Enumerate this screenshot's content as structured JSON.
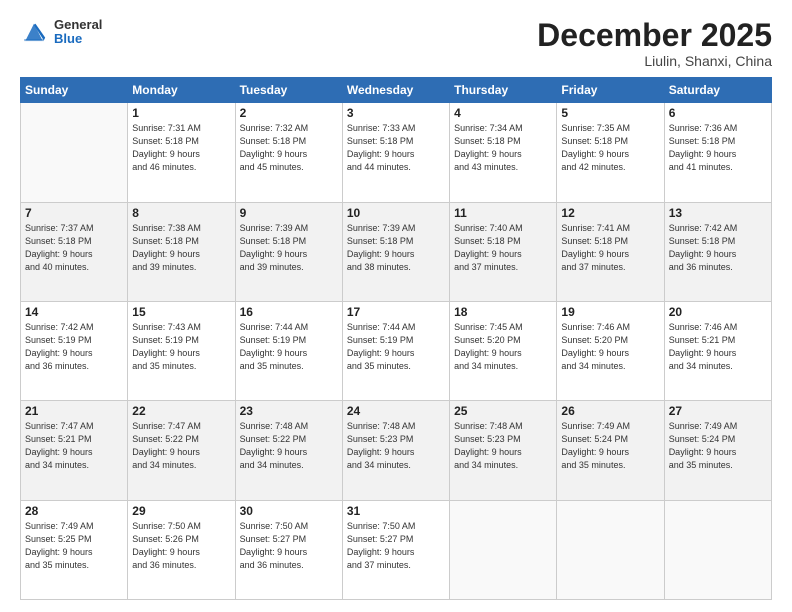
{
  "header": {
    "logo": {
      "general": "General",
      "blue": "Blue"
    },
    "month": "December 2025",
    "location": "Liulin, Shanxi, China"
  },
  "weekdays": [
    "Sunday",
    "Monday",
    "Tuesday",
    "Wednesday",
    "Thursday",
    "Friday",
    "Saturday"
  ],
  "weeks": [
    [
      {
        "day": "",
        "sunrise": "",
        "sunset": "",
        "daylight": ""
      },
      {
        "day": "1",
        "sunrise": "Sunrise: 7:31 AM",
        "sunset": "Sunset: 5:18 PM",
        "daylight": "Daylight: 9 hours and 46 minutes."
      },
      {
        "day": "2",
        "sunrise": "Sunrise: 7:32 AM",
        "sunset": "Sunset: 5:18 PM",
        "daylight": "Daylight: 9 hours and 45 minutes."
      },
      {
        "day": "3",
        "sunrise": "Sunrise: 7:33 AM",
        "sunset": "Sunset: 5:18 PM",
        "daylight": "Daylight: 9 hours and 44 minutes."
      },
      {
        "day": "4",
        "sunrise": "Sunrise: 7:34 AM",
        "sunset": "Sunset: 5:18 PM",
        "daylight": "Daylight: 9 hours and 43 minutes."
      },
      {
        "day": "5",
        "sunrise": "Sunrise: 7:35 AM",
        "sunset": "Sunset: 5:18 PM",
        "daylight": "Daylight: 9 hours and 42 minutes."
      },
      {
        "day": "6",
        "sunrise": "Sunrise: 7:36 AM",
        "sunset": "Sunset: 5:18 PM",
        "daylight": "Daylight: 9 hours and 41 minutes."
      }
    ],
    [
      {
        "day": "7",
        "sunrise": "Sunrise: 7:37 AM",
        "sunset": "Sunset: 5:18 PM",
        "daylight": "Daylight: 9 hours and 40 minutes."
      },
      {
        "day": "8",
        "sunrise": "Sunrise: 7:38 AM",
        "sunset": "Sunset: 5:18 PM",
        "daylight": "Daylight: 9 hours and 39 minutes."
      },
      {
        "day": "9",
        "sunrise": "Sunrise: 7:39 AM",
        "sunset": "Sunset: 5:18 PM",
        "daylight": "Daylight: 9 hours and 39 minutes."
      },
      {
        "day": "10",
        "sunrise": "Sunrise: 7:39 AM",
        "sunset": "Sunset: 5:18 PM",
        "daylight": "Daylight: 9 hours and 38 minutes."
      },
      {
        "day": "11",
        "sunrise": "Sunrise: 7:40 AM",
        "sunset": "Sunset: 5:18 PM",
        "daylight": "Daylight: 9 hours and 37 minutes."
      },
      {
        "day": "12",
        "sunrise": "Sunrise: 7:41 AM",
        "sunset": "Sunset: 5:18 PM",
        "daylight": "Daylight: 9 hours and 37 minutes."
      },
      {
        "day": "13",
        "sunrise": "Sunrise: 7:42 AM",
        "sunset": "Sunset: 5:18 PM",
        "daylight": "Daylight: 9 hours and 36 minutes."
      }
    ],
    [
      {
        "day": "14",
        "sunrise": "Sunrise: 7:42 AM",
        "sunset": "Sunset: 5:19 PM",
        "daylight": "Daylight: 9 hours and 36 minutes."
      },
      {
        "day": "15",
        "sunrise": "Sunrise: 7:43 AM",
        "sunset": "Sunset: 5:19 PM",
        "daylight": "Daylight: 9 hours and 35 minutes."
      },
      {
        "day": "16",
        "sunrise": "Sunrise: 7:44 AM",
        "sunset": "Sunset: 5:19 PM",
        "daylight": "Daylight: 9 hours and 35 minutes."
      },
      {
        "day": "17",
        "sunrise": "Sunrise: 7:44 AM",
        "sunset": "Sunset: 5:19 PM",
        "daylight": "Daylight: 9 hours and 35 minutes."
      },
      {
        "day": "18",
        "sunrise": "Sunrise: 7:45 AM",
        "sunset": "Sunset: 5:20 PM",
        "daylight": "Daylight: 9 hours and 34 minutes."
      },
      {
        "day": "19",
        "sunrise": "Sunrise: 7:46 AM",
        "sunset": "Sunset: 5:20 PM",
        "daylight": "Daylight: 9 hours and 34 minutes."
      },
      {
        "day": "20",
        "sunrise": "Sunrise: 7:46 AM",
        "sunset": "Sunset: 5:21 PM",
        "daylight": "Daylight: 9 hours and 34 minutes."
      }
    ],
    [
      {
        "day": "21",
        "sunrise": "Sunrise: 7:47 AM",
        "sunset": "Sunset: 5:21 PM",
        "daylight": "Daylight: 9 hours and 34 minutes."
      },
      {
        "day": "22",
        "sunrise": "Sunrise: 7:47 AM",
        "sunset": "Sunset: 5:22 PM",
        "daylight": "Daylight: 9 hours and 34 minutes."
      },
      {
        "day": "23",
        "sunrise": "Sunrise: 7:48 AM",
        "sunset": "Sunset: 5:22 PM",
        "daylight": "Daylight: 9 hours and 34 minutes."
      },
      {
        "day": "24",
        "sunrise": "Sunrise: 7:48 AM",
        "sunset": "Sunset: 5:23 PM",
        "daylight": "Daylight: 9 hours and 34 minutes."
      },
      {
        "day": "25",
        "sunrise": "Sunrise: 7:48 AM",
        "sunset": "Sunset: 5:23 PM",
        "daylight": "Daylight: 9 hours and 34 minutes."
      },
      {
        "day": "26",
        "sunrise": "Sunrise: 7:49 AM",
        "sunset": "Sunset: 5:24 PM",
        "daylight": "Daylight: 9 hours and 35 minutes."
      },
      {
        "day": "27",
        "sunrise": "Sunrise: 7:49 AM",
        "sunset": "Sunset: 5:24 PM",
        "daylight": "Daylight: 9 hours and 35 minutes."
      }
    ],
    [
      {
        "day": "28",
        "sunrise": "Sunrise: 7:49 AM",
        "sunset": "Sunset: 5:25 PM",
        "daylight": "Daylight: 9 hours and 35 minutes."
      },
      {
        "day": "29",
        "sunrise": "Sunrise: 7:50 AM",
        "sunset": "Sunset: 5:26 PM",
        "daylight": "Daylight: 9 hours and 36 minutes."
      },
      {
        "day": "30",
        "sunrise": "Sunrise: 7:50 AM",
        "sunset": "Sunset: 5:27 PM",
        "daylight": "Daylight: 9 hours and 36 minutes."
      },
      {
        "day": "31",
        "sunrise": "Sunrise: 7:50 AM",
        "sunset": "Sunset: 5:27 PM",
        "daylight": "Daylight: 9 hours and 37 minutes."
      },
      {
        "day": "",
        "sunrise": "",
        "sunset": "",
        "daylight": ""
      },
      {
        "day": "",
        "sunrise": "",
        "sunset": "",
        "daylight": ""
      },
      {
        "day": "",
        "sunrise": "",
        "sunset": "",
        "daylight": ""
      }
    ]
  ]
}
